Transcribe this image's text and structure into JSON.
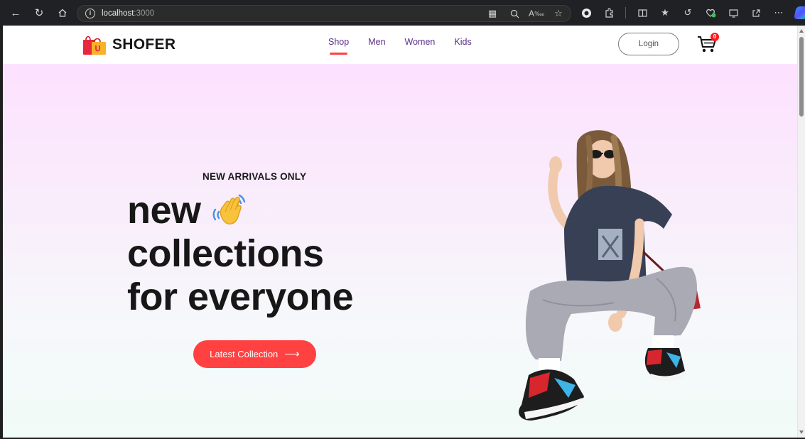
{
  "browser": {
    "url_host": "localhost",
    "url_port": ":3000"
  },
  "site": {
    "brand": "SHOFER",
    "menu": [
      {
        "label": "Shop",
        "active": true
      },
      {
        "label": "Men",
        "active": false
      },
      {
        "label": "Women",
        "active": false
      },
      {
        "label": "Kids",
        "active": false
      }
    ],
    "login_label": "Login",
    "cart_count": "0"
  },
  "hero": {
    "eyebrow": "NEW ARRIVALS ONLY",
    "line1": "new",
    "line2": "collections",
    "line3": "for everyone",
    "cta_label": "Latest Collection",
    "cta_arrow": "⟶"
  },
  "colors": {
    "accent": "#ff4141",
    "nav_text": "#5a2f86",
    "headline": "#171717"
  },
  "icons": {
    "hand": "waving-hand-icon",
    "cart": "cart-icon",
    "logo": "shopping-bag-icon"
  }
}
